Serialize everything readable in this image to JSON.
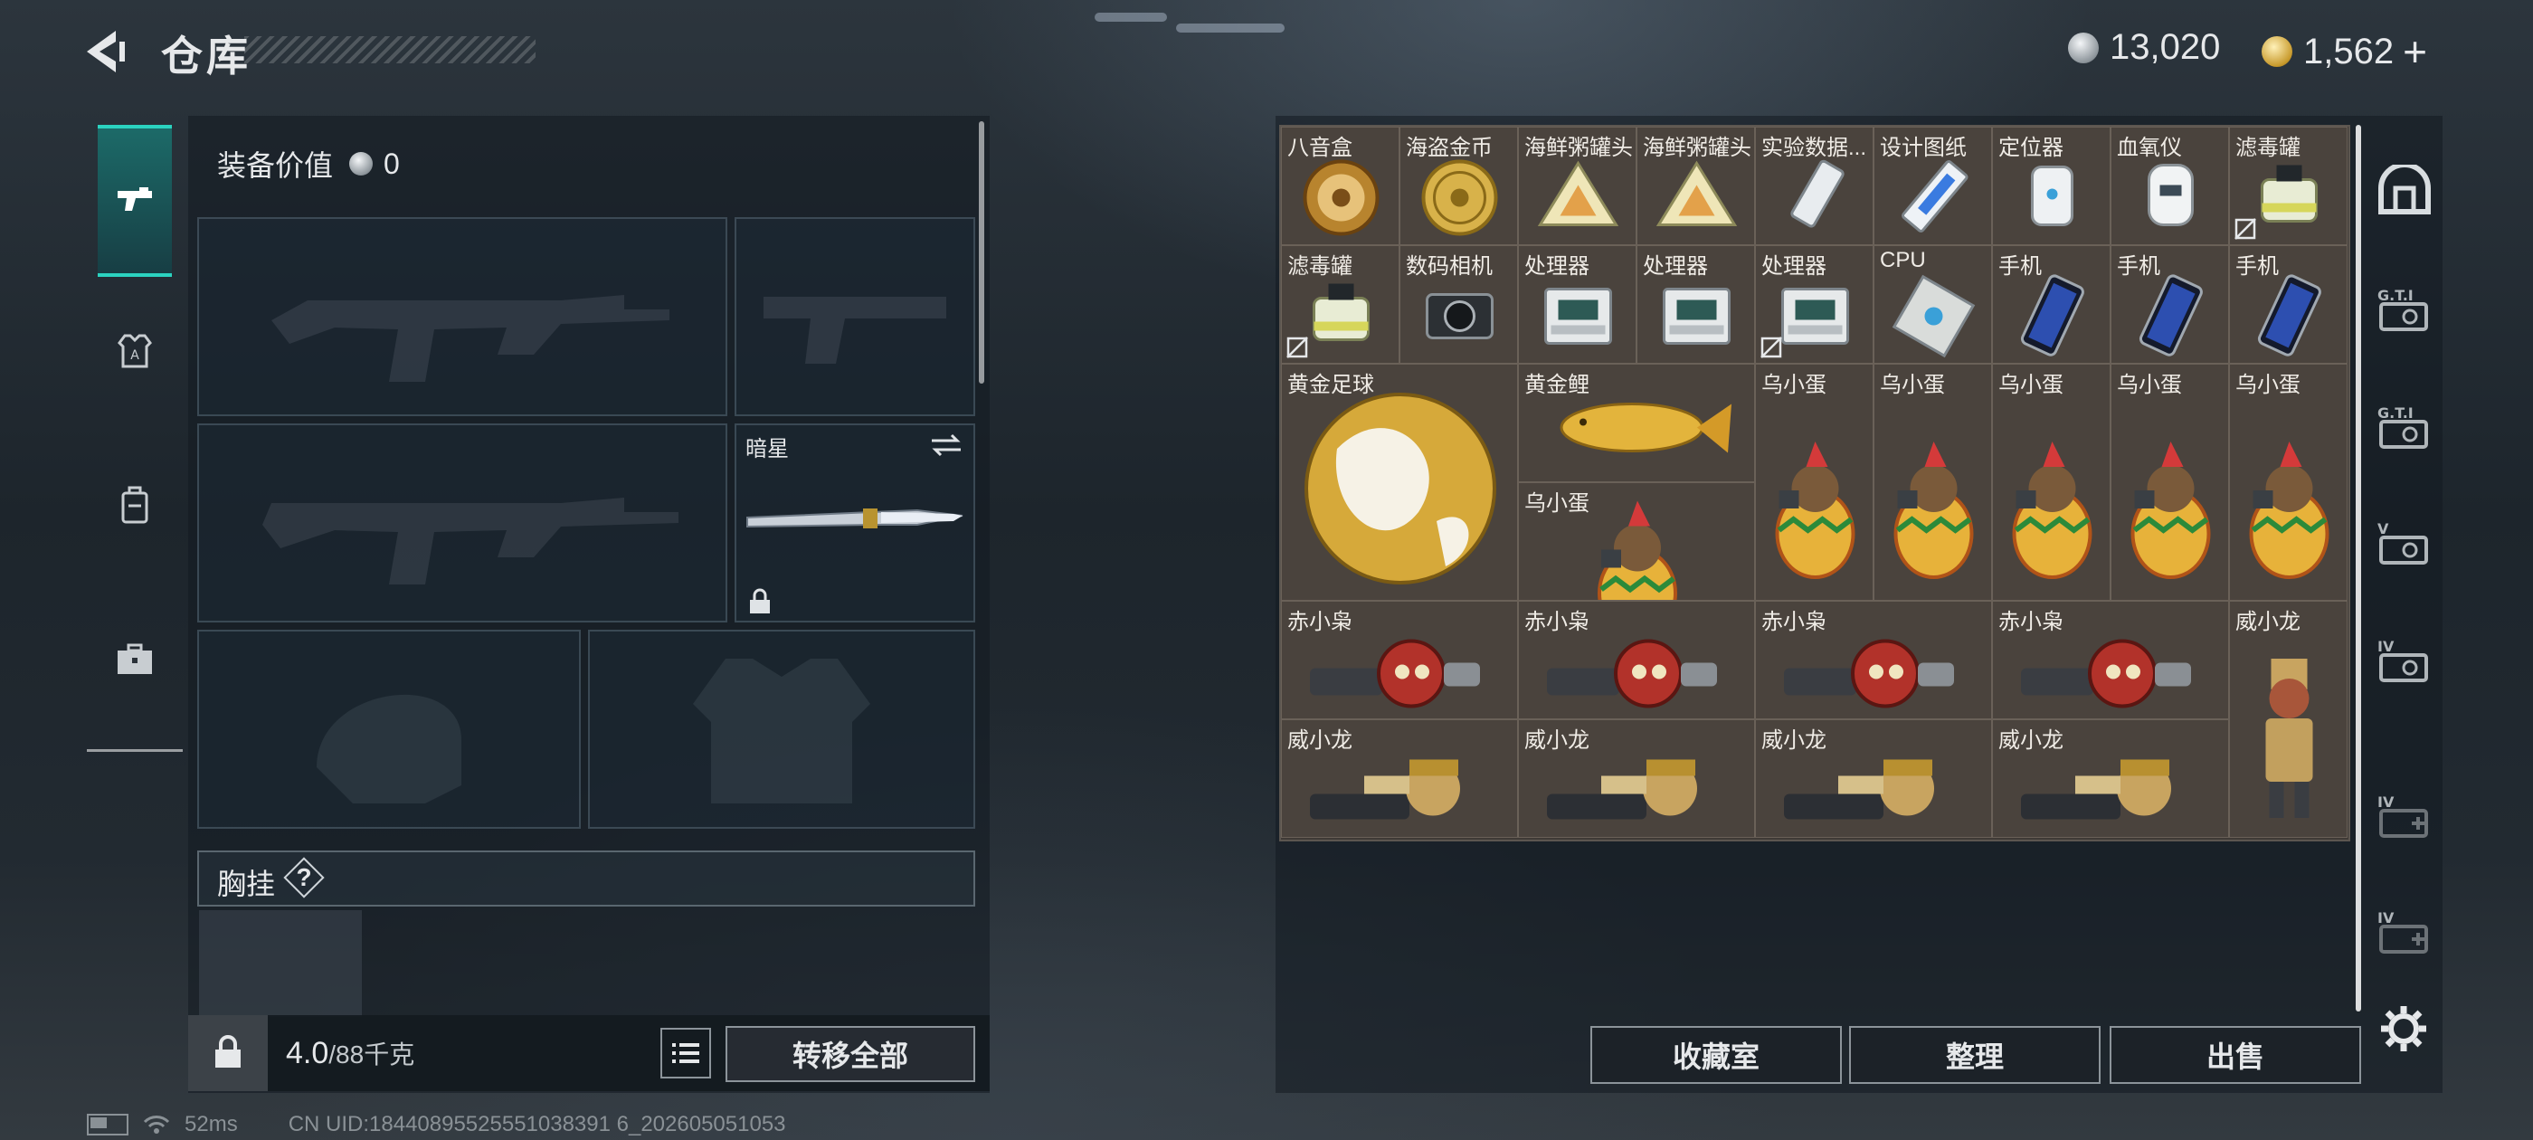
{
  "header": {
    "title": "仓库",
    "back_icon": "back-arrow-icon"
  },
  "currency": [
    {
      "icon": "silver-coin-icon",
      "value": "13,020"
    },
    {
      "icon": "gold-coin-icon",
      "value": "1,562"
    }
  ],
  "add_currency_label": "+",
  "left_tabs": [
    {
      "icon": "gun-icon",
      "active": true
    },
    {
      "icon": "armor-icon",
      "active": false
    },
    {
      "icon": "backpack-icon",
      "active": false
    },
    {
      "icon": "toolbox-icon",
      "active": false
    }
  ],
  "equipment": {
    "value_label": "装备价值",
    "value": "0",
    "melee_name": "暗星",
    "rig_label": "胸挂",
    "help_label": "?"
  },
  "bottom": {
    "weight_current": "4.0",
    "weight_capacity": "/88千克",
    "transfer_all": "转移全部"
  },
  "storage_items": [
    {
      "name": "八音盒",
      "icon": "music-box-icon"
    },
    {
      "name": "海盗金币",
      "icon": "gold-coin-icon"
    },
    {
      "name": "海鲜粥罐头",
      "icon": "canned-food-icon"
    },
    {
      "name": "海鲜粥罐头",
      "icon": "canned-food-icon"
    },
    {
      "name": "实验数据...",
      "icon": "usb-drive-icon"
    },
    {
      "name": "设计图纸",
      "icon": "blueprint-icon"
    },
    {
      "name": "定位器",
      "icon": "locator-icon"
    },
    {
      "name": "血氧仪",
      "icon": "oximeter-icon"
    },
    {
      "name": "滤毒罐",
      "icon": "filter-canister-icon"
    },
    {
      "name": "滤毒罐",
      "icon": "filter-canister-icon"
    },
    {
      "name": "数码相机",
      "icon": "camera-icon"
    },
    {
      "name": "处理器",
      "icon": "processor-icon"
    },
    {
      "name": "处理器",
      "icon": "processor-icon"
    },
    {
      "name": "处理器",
      "icon": "processor-icon"
    },
    {
      "name": "CPU",
      "icon": "cpu-icon"
    },
    {
      "name": "手机",
      "icon": "phone-icon"
    },
    {
      "name": "手机",
      "icon": "phone-icon"
    },
    {
      "name": "手机",
      "icon": "phone-icon"
    },
    {
      "name": "黄金足球",
      "icon": "golden-football-icon"
    },
    {
      "name": "黄金鲤",
      "icon": "golden-carp-icon"
    },
    {
      "name": "乌小蛋",
      "icon": "egg-figure-icon"
    },
    {
      "name": "乌小蛋",
      "icon": "egg-figure-icon"
    },
    {
      "name": "乌小蛋",
      "icon": "egg-figure-icon"
    },
    {
      "name": "乌小蛋",
      "icon": "egg-figure-icon"
    },
    {
      "name": "乌小蛋",
      "icon": "egg-figure-icon"
    },
    {
      "name": "乌小蛋",
      "icon": "egg-figure-icon"
    },
    {
      "name": "赤小枭",
      "icon": "owl-figure-icon"
    },
    {
      "name": "赤小枭",
      "icon": "owl-figure-icon"
    },
    {
      "name": "赤小枭",
      "icon": "owl-figure-icon"
    },
    {
      "name": "赤小枭",
      "icon": "owl-figure-icon"
    },
    {
      "name": "威小龙",
      "icon": "dragon-figure-icon"
    },
    {
      "name": "威小龙",
      "icon": "dragon-figure-icon"
    },
    {
      "name": "威小龙",
      "icon": "dragon-figure-icon"
    },
    {
      "name": "威小龙",
      "icon": "dragon-figure-icon"
    },
    {
      "name": "威小龙",
      "icon": "dragon-figure-icon"
    }
  ],
  "right_tabs": [
    {
      "icon": "vault-icon",
      "label": ""
    },
    {
      "icon": "storage-case-icon",
      "label": "G.T.I"
    },
    {
      "icon": "storage-case-icon",
      "label": "G.T.I"
    },
    {
      "icon": "storage-case-icon",
      "label": "V"
    },
    {
      "icon": "storage-case-icon",
      "label": "IV"
    },
    {
      "icon": "storage-case-add-icon",
      "label": "IV"
    },
    {
      "icon": "storage-case-add-icon",
      "label": "IV"
    }
  ],
  "actions": {
    "collection": "收藏室",
    "organize": "整理",
    "sell": "出售"
  },
  "status": {
    "ping": "52ms",
    "uid": "CN UID:18440895525551038391 6_202605051053"
  },
  "colors": {
    "accent": "#2bd3c0",
    "cell_bg": "#4a433d",
    "panel_bg": "#121a21"
  }
}
